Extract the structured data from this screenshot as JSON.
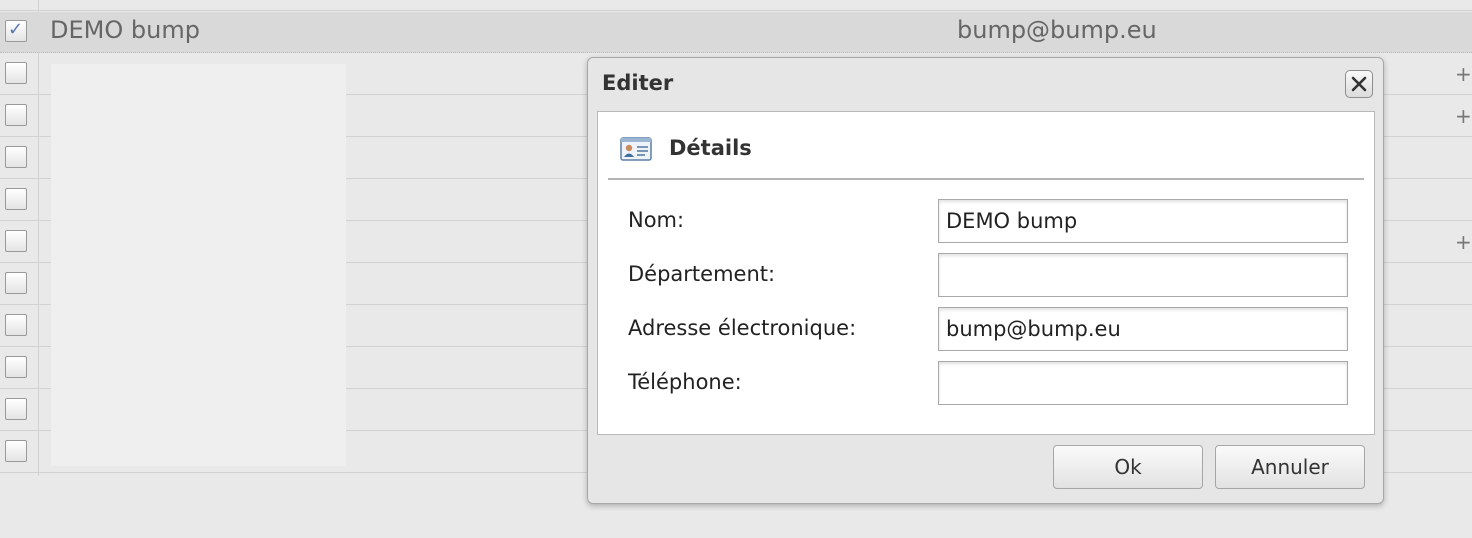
{
  "list": {
    "selected_row": {
      "name": "DEMO bump",
      "email": "bump@bump.eu",
      "checked": true
    },
    "plus_label": "+"
  },
  "dialog": {
    "title": "Editer",
    "section_title": "Détails",
    "fields": [
      {
        "label": "Nom:",
        "value": "DEMO bump",
        "placeholder": ""
      },
      {
        "label": "Département:",
        "value": "",
        "placeholder": ""
      },
      {
        "label": "Adresse électronique:",
        "value": "bump@bump.eu",
        "placeholder": ""
      },
      {
        "label": "Téléphone:",
        "value": "",
        "placeholder": ""
      }
    ],
    "ok_label": "Ok",
    "cancel_label": "Annuler"
  },
  "icons": {
    "close": "close-icon",
    "section": "contact-card-icon",
    "checkbox_checked": "checkmark-icon"
  },
  "colors": {
    "check_tick": "#5a74b8",
    "background": "#e9e9e9",
    "dialog_background": "#e6e6e6",
    "panel_background": "#ffffff"
  }
}
